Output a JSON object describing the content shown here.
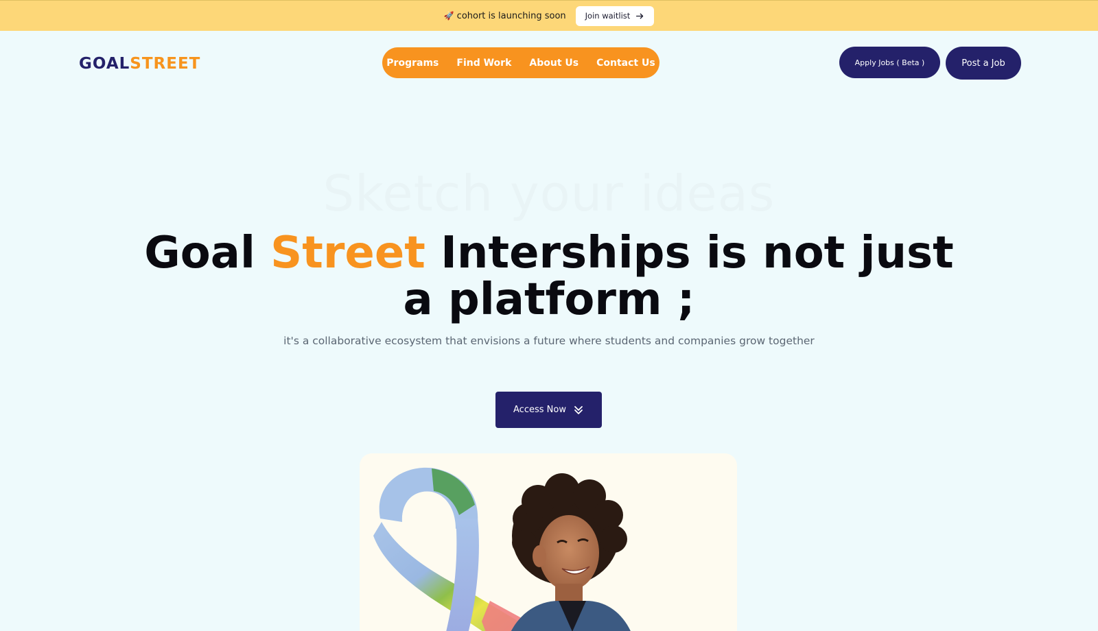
{
  "announcement": {
    "icon": "rocket-icon",
    "text": "cohort is launching soon",
    "button_label": "Join waitlist"
  },
  "logo": {
    "part1": "GOAL",
    "part2": "STREET"
  },
  "nav": {
    "items": [
      {
        "label": "Programs"
      },
      {
        "label": "Find Work"
      },
      {
        "label": "About Us"
      },
      {
        "label": "Contact Us"
      }
    ]
  },
  "actions": {
    "apply_label": "Apply Jobs ( Beta )",
    "post_label": "Post a Job"
  },
  "hero": {
    "ghost_text": "Sketch your ideas",
    "headline_part1": "Goal ",
    "headline_accent": "Street",
    "headline_part2": " Interships is not just a platform ;",
    "subheadline": "it's a collaborative ecosystem that envisions a future where students and companies grow together",
    "cta_label": "Access Now"
  },
  "colors": {
    "brand_navy": "#24216a",
    "brand_orange": "#f8931f",
    "announce_bg": "#fdd778",
    "page_bg": "#eefafc"
  }
}
